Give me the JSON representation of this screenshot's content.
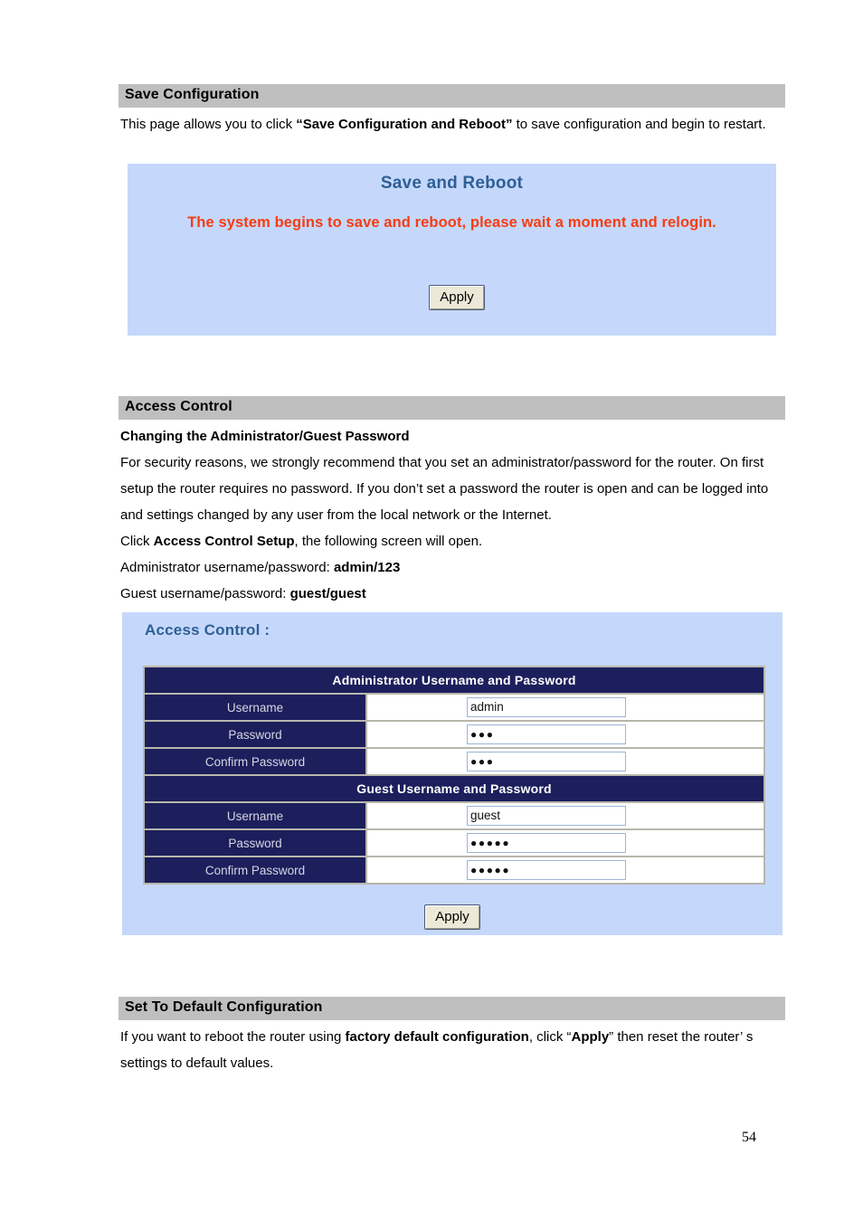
{
  "page": {
    "number": "54"
  },
  "sections": {
    "save_configuration": {
      "heading": "Save Configuration",
      "paragraph_part1": "This page allows you to click ",
      "paragraph_bold": "“Save Configuration and Reboot”",
      "paragraph_part2": " to save configuration and begin to restart."
    },
    "access_control": {
      "heading": "Access Control",
      "subheading": "Changing the Administrator/Guest Password",
      "paragraph1": "For security reasons, we strongly recommend that you set an administrator/password for the router. On first setup the router requires no password. If you don’t set a password the router is open and can be logged into and settings changed by any user from the local network or the Internet.",
      "line2_pre": "Click ",
      "line2_bold": "Access Control Setup",
      "line2_post": ", the following screen will open.",
      "line3_pre": "Administrator username/password: ",
      "line3_bold": "admin/123",
      "line4_pre": "Guest username/password: ",
      "line4_bold": "guest/guest"
    },
    "set_to_default": {
      "heading": "Set To Default Configuration",
      "paragraph_pre": "If you want to reboot the router using ",
      "paragraph_bold1": "factory default configuration",
      "paragraph_mid": ", click “",
      "paragraph_bold2": "Apply",
      "paragraph_post": "” then reset the router’ s settings to default values."
    }
  },
  "save_reboot_panel": {
    "title": "Save and Reboot",
    "alert": "The system begins to save and reboot, please wait a moment and relogin.",
    "apply_label": "Apply",
    "background_color": "#c5d8fb",
    "title_color": "#2f5f94",
    "alert_color": "#f63c12"
  },
  "access_control_panel": {
    "title": "Access Control :",
    "apply_label": "Apply",
    "background_color": "#c5d8fb",
    "header_row_color": "#1c1f5c",
    "groups": [
      {
        "header": "Administrator Username and Password",
        "rows": [
          {
            "label": "Username",
            "value": "admin",
            "masked": false
          },
          {
            "label": "Password",
            "value": "●●●",
            "masked": true
          },
          {
            "label": "Confirm Password",
            "value": "●●●",
            "masked": true
          }
        ]
      },
      {
        "header": "Guest Username and Password",
        "rows": [
          {
            "label": "Username",
            "value": "guest",
            "masked": false
          },
          {
            "label": "Password",
            "value": "●●●●●",
            "masked": true
          },
          {
            "label": "Confirm Password",
            "value": "●●●●●",
            "masked": true
          }
        ]
      }
    ]
  }
}
